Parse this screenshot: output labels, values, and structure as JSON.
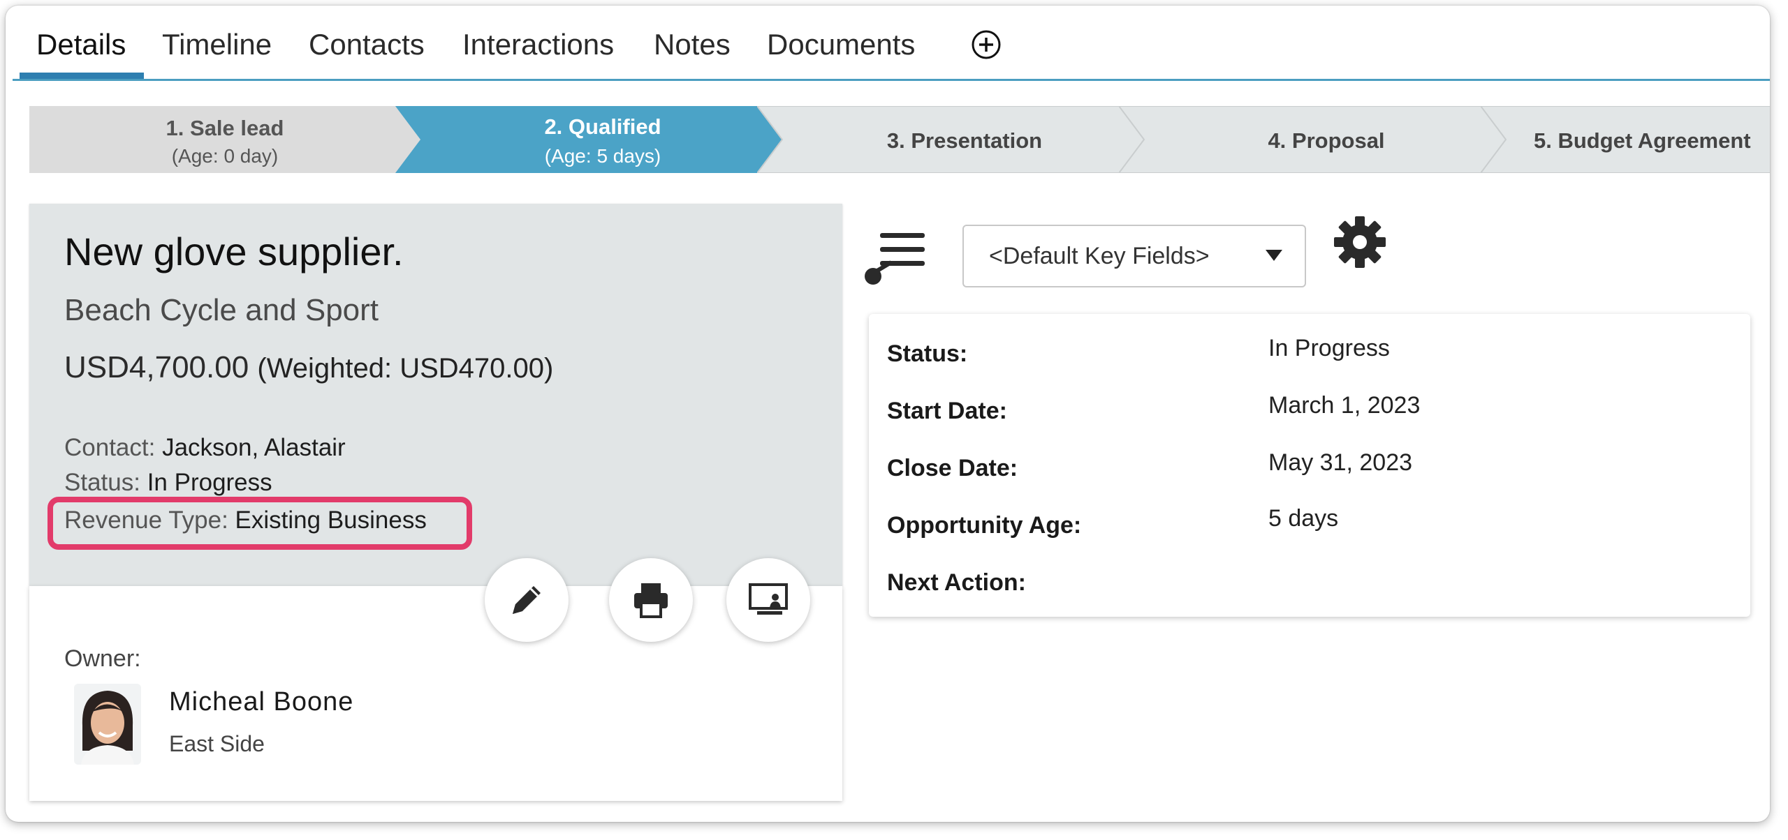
{
  "tabs": [
    {
      "label": "Details"
    },
    {
      "label": "Timeline"
    },
    {
      "label": "Contacts"
    },
    {
      "label": "Interactions"
    },
    {
      "label": "Notes"
    },
    {
      "label": "Documents"
    }
  ],
  "stages": [
    {
      "name": "1. Sale lead",
      "age": "(Age: 0 day)"
    },
    {
      "name": "2. Qualified",
      "age": "(Age: 5 days)"
    },
    {
      "name": "3. Presentation"
    },
    {
      "name": "4. Proposal"
    },
    {
      "name": "5. Budget Agreement"
    }
  ],
  "summary": {
    "title": "New glove supplier.",
    "account": "Beach Cycle and Sport",
    "amount": "USD4,700.00",
    "weighted": "(Weighted: USD470.00)",
    "contact_label": "Contact:",
    "contact_value": "Jackson, Alastair",
    "status_label": "Status:",
    "status_value": "In Progress",
    "revenue_label": "Revenue Type:",
    "revenue_value": "Existing Business"
  },
  "owner": {
    "label": "Owner:",
    "name": "Micheal Boone",
    "location": "East Side"
  },
  "key_fields": {
    "selector": "<Default Key Fields>",
    "rows": [
      {
        "label": "Status:",
        "value": "In Progress"
      },
      {
        "label": "Start Date:",
        "value": "March 1, 2023"
      },
      {
        "label": "Close Date:",
        "value": "May 31, 2023"
      },
      {
        "label": "Opportunity Age:",
        "value": "5 days"
      },
      {
        "label": "Next Action:",
        "value": ""
      }
    ]
  },
  "colors": {
    "accent": "#2e7fb0",
    "active_stage": "#4ba3c7",
    "highlight": "#e23b6a"
  },
  "icons": [
    "add-tab-icon",
    "edit-pencil-icon",
    "print-icon",
    "presentation-icon",
    "key-fields-icon",
    "gear-icon",
    "caret-down-icon"
  ]
}
